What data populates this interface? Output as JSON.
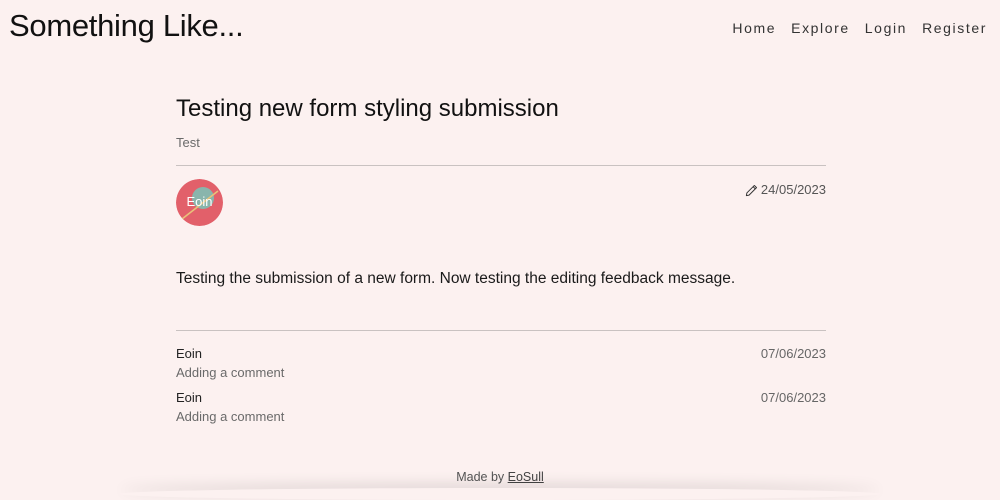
{
  "header": {
    "site_title": "Something Like...",
    "nav": [
      {
        "label": "Home"
      },
      {
        "label": "Explore"
      },
      {
        "label": "Login"
      },
      {
        "label": "Register"
      }
    ]
  },
  "post": {
    "title": "Testing new form styling submission",
    "subtitle": "Test",
    "date": "24/05/2023",
    "author_avatar_text": "Eoin",
    "body": "Testing the submission of a new form. Now testing the editing feedback message."
  },
  "comments": [
    {
      "author": "Eoin",
      "text": "Adding a comment",
      "date": "07/06/2023"
    },
    {
      "author": "Eoin",
      "text": "Adding a comment",
      "date": "07/06/2023"
    }
  ],
  "footer": {
    "prefix": "Made by ",
    "link_label": "EoSull"
  },
  "colors": {
    "background": "#fcf1f0",
    "avatar_bg": "#e2606a",
    "avatar_inner": "#7fbfb4"
  },
  "icons": {
    "edit": "pencil-icon"
  }
}
